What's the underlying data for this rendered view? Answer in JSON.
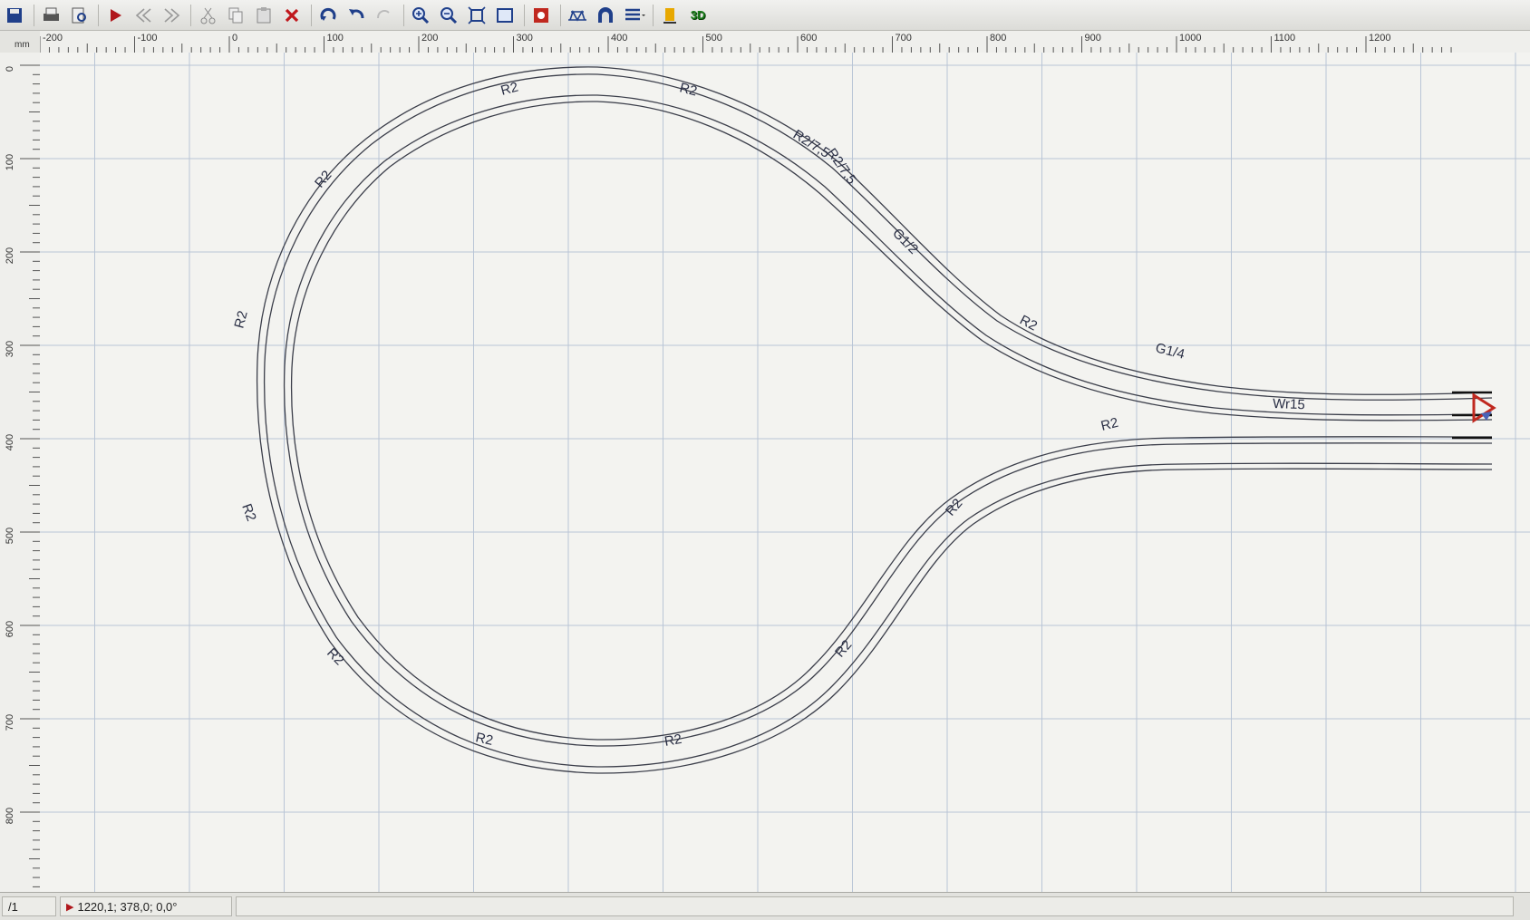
{
  "toolbar": {
    "buttons": [
      {
        "name": "save-icon"
      },
      {
        "name": "print-icon"
      },
      {
        "name": "print-preview-icon"
      },
      {
        "name": "run-icon"
      },
      {
        "name": "step-back-icon"
      },
      {
        "name": "step-forward-icon"
      },
      {
        "name": "cut-icon"
      },
      {
        "name": "copy-icon"
      },
      {
        "name": "paste-icon"
      },
      {
        "name": "delete-icon"
      },
      {
        "name": "rotate-icon"
      },
      {
        "name": "undo-icon"
      },
      {
        "name": "redo-icon"
      },
      {
        "name": "zoom-in-icon"
      },
      {
        "name": "zoom-out-icon"
      },
      {
        "name": "zoom-fit-icon"
      },
      {
        "name": "zoom-window-icon"
      },
      {
        "name": "connect-icon"
      },
      {
        "name": "bridge-icon"
      },
      {
        "name": "tunnel-icon"
      },
      {
        "name": "layers-icon"
      },
      {
        "name": "train-icon"
      }
    ],
    "view3d_label": "3D"
  },
  "ruler": {
    "unit": "mm",
    "h_labels": [
      "-200",
      "-100",
      "0",
      "100",
      "200",
      "300",
      "400",
      "500",
      "600",
      "700",
      "800",
      "900",
      "1000",
      "1100",
      "1200"
    ],
    "v_labels": [
      "0",
      "100",
      "200",
      "300",
      "400",
      "500",
      "600",
      "700",
      "800"
    ]
  },
  "tracks": {
    "labels": [
      "R2",
      "R2",
      "R2/7,5",
      "R2/7,5",
      "G1/2",
      "R2",
      "G1/4",
      "Wr15",
      "R2",
      "R2",
      "R2",
      "R2",
      "R2",
      "R2",
      "R2",
      "R2"
    ]
  },
  "status": {
    "left": "/1",
    "coords": "1220,1; 378,0; 0,0°"
  },
  "colors": {
    "track": "#3b3e4a",
    "grid": "#b9c5d6",
    "accent": "#c0281f"
  }
}
